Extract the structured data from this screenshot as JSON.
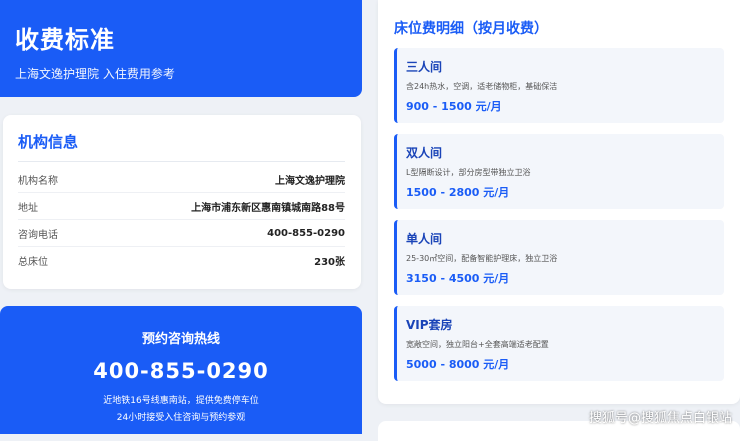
{
  "hero": {
    "title": "收费标准",
    "subtitle": "上海文逸护理院 入住费用参考"
  },
  "info": {
    "title": "机构信息",
    "rows": [
      {
        "label": "机构名称",
        "value": "上海文逸护理院"
      },
      {
        "label": "地址",
        "value": "上海市浦东新区惠南镇城南路88号"
      },
      {
        "label": "咨询电话",
        "value": "400-855-0290"
      },
      {
        "label": "总床位",
        "value": "230张"
      }
    ]
  },
  "hotline": {
    "title": "预约咨询热线",
    "number": "400-855-0290",
    "line1": "近地铁16号线惠南站，提供免费停车位",
    "line2": "24小时接受入住咨询与预约参观"
  },
  "pricing": {
    "title": "床位费明细（按月收费）",
    "rooms": [
      {
        "name": "三人间",
        "desc": "含24h热水，空调，适老储物柜，基础保洁",
        "price": "900 - 1500 元/月"
      },
      {
        "name": "双人间",
        "desc": "L型隔断设计，部分房型带独立卫浴",
        "price": "1500 - 2800 元/月"
      },
      {
        "name": "单人间",
        "desc": "25-30㎡空间，配备智能护理床，独立卫浴",
        "price": "3150 - 4500 元/月"
      },
      {
        "name": "VIP套房",
        "desc": "宽敞空间，独立阳台+全套高端适老配置",
        "price": "5000 - 8000 元/月"
      }
    ]
  },
  "watermark": "搜狐号@搜狐焦点白银站",
  "colors": {
    "accent": "#1a5cf6",
    "background": "#eef1f6"
  }
}
